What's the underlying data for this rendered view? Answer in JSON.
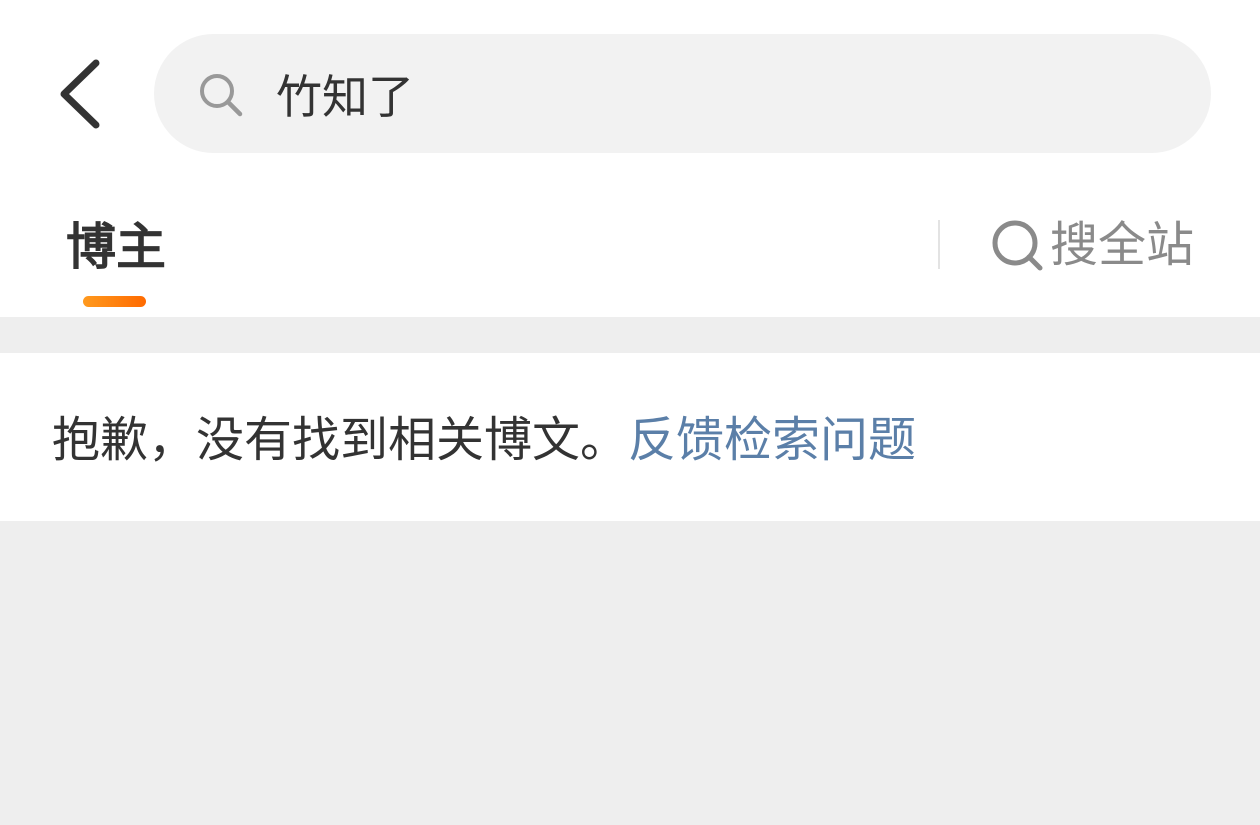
{
  "header": {
    "search_query": "竹知了"
  },
  "tabs": {
    "active_label": "博主",
    "search_all_label": "搜全站"
  },
  "results": {
    "empty_message": "抱歉，没有找到相关博文。",
    "feedback_link": "反馈检索问题"
  },
  "colors": {
    "accent_orange": "#ff7a00",
    "link_blue": "#5b7fa8",
    "text_primary": "#333333",
    "text_secondary": "#8a8a8a",
    "background_gray": "#eeeeee"
  },
  "icons": {
    "back": "chevron-left-icon",
    "search": "search-icon"
  }
}
